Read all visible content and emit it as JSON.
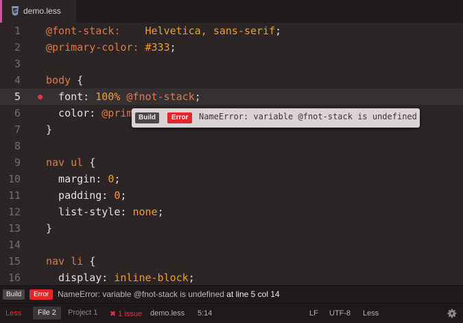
{
  "tab": {
    "label": "demo.less",
    "icon": "css3-icon"
  },
  "code_lines": [
    {
      "num": "1",
      "tokens": [
        {
          "t": "@font-stack:    ",
          "c": "var"
        },
        {
          "t": "Helvetica, sans-serif",
          "c": "val"
        },
        {
          "t": ";",
          "c": "punc"
        }
      ]
    },
    {
      "num": "2",
      "tokens": [
        {
          "t": "@primary-color: ",
          "c": "var"
        },
        {
          "t": "#333",
          "c": "val"
        },
        {
          "t": ";",
          "c": "punc"
        }
      ]
    },
    {
      "num": "3",
      "tokens": []
    },
    {
      "num": "4",
      "tokens": [
        {
          "t": "body ",
          "c": "sel"
        },
        {
          "t": "{",
          "c": "punc"
        }
      ]
    },
    {
      "num": "5",
      "tokens": [
        {
          "t": "  font: ",
          "c": "prop"
        },
        {
          "t": "100% ",
          "c": "num"
        },
        {
          "t": "@fnot-stack",
          "c": "var"
        },
        {
          "t": ";",
          "c": "punc"
        }
      ]
    },
    {
      "num": "6",
      "tokens": [
        {
          "t": "  color: ",
          "c": "prop"
        },
        {
          "t": "@primary-color",
          "c": "var"
        },
        {
          "t": ";",
          "c": "punc"
        }
      ]
    },
    {
      "num": "7",
      "tokens": [
        {
          "t": "}",
          "c": "punc"
        }
      ]
    },
    {
      "num": "8",
      "tokens": []
    },
    {
      "num": "9",
      "tokens": [
        {
          "t": "nav ul ",
          "c": "sel"
        },
        {
          "t": "{",
          "c": "punc"
        }
      ]
    },
    {
      "num": "10",
      "tokens": [
        {
          "t": "  margin: ",
          "c": "prop"
        },
        {
          "t": "0",
          "c": "num"
        },
        {
          "t": ";",
          "c": "punc"
        }
      ]
    },
    {
      "num": "11",
      "tokens": [
        {
          "t": "  padding: ",
          "c": "prop"
        },
        {
          "t": "0",
          "c": "num"
        },
        {
          "t": ";",
          "c": "punc"
        }
      ]
    },
    {
      "num": "12",
      "tokens": [
        {
          "t": "  list-style: ",
          "c": "prop"
        },
        {
          "t": "none",
          "c": "val"
        },
        {
          "t": ";",
          "c": "punc"
        }
      ]
    },
    {
      "num": "13",
      "tokens": [
        {
          "t": "}",
          "c": "punc"
        }
      ]
    },
    {
      "num": "14",
      "tokens": []
    },
    {
      "num": "15",
      "tokens": [
        {
          "t": "nav li ",
          "c": "sel"
        },
        {
          "t": "{",
          "c": "punc"
        }
      ]
    },
    {
      "num": "16",
      "tokens": [
        {
          "t": "  display: ",
          "c": "prop"
        },
        {
          "t": "inline-block",
          "c": "val"
        },
        {
          "t": ";",
          "c": "punc"
        }
      ]
    }
  ],
  "current_line": "5",
  "error_line": "5",
  "tooltip": {
    "build": "Build",
    "error": "Error",
    "message": "NameError: variable @fnot-stack is undefined"
  },
  "message_bar": {
    "build": "Build",
    "error": "Error",
    "message": "NameError: variable @fnot-stack is undefined",
    "location": "at line 5 col 14"
  },
  "status": {
    "grammar_left": "Less",
    "file_tab": "File 2",
    "project_tab": "Project 1",
    "issues": "1 issue",
    "filename": "demo.less",
    "cursor": "5:14",
    "line_ending": "LF",
    "encoding": "UTF-8",
    "grammar": "Less"
  },
  "colors": {
    "accent_error": "#e0272d",
    "variable": "#e17a4a",
    "value": "#f59d29"
  }
}
